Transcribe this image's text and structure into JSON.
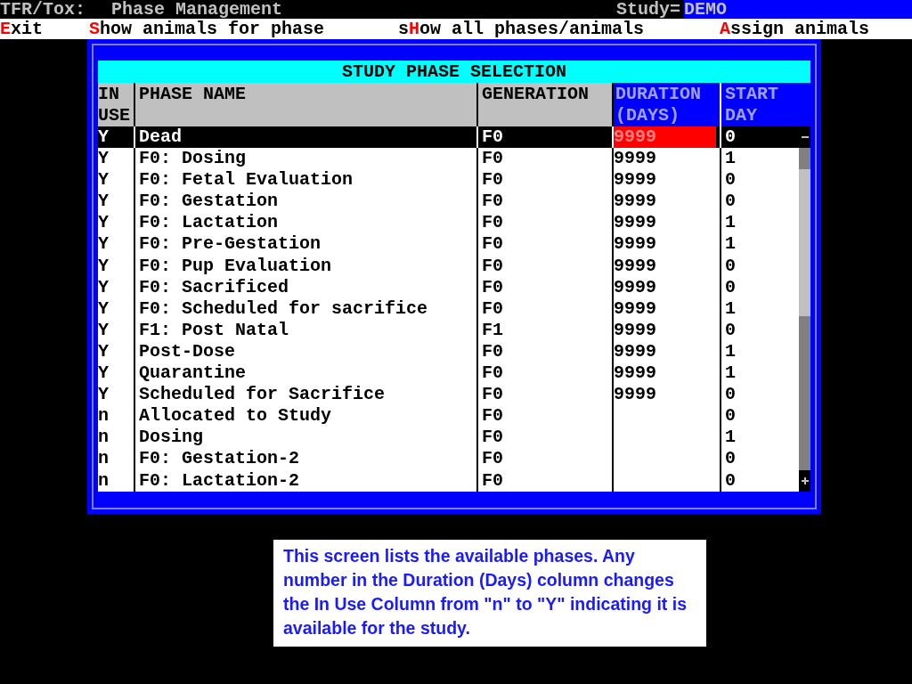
{
  "title_bar": {
    "app": "TFR/Tox:",
    "screen": "Phase Management",
    "study_label": "Study=",
    "study_value": "DEMO"
  },
  "menu": [
    {
      "key": "E",
      "after": "xit"
    },
    {
      "key": "S",
      "after": "how animals for phase"
    },
    {
      "before": "s",
      "key": "H",
      "after": "ow all phases/animals"
    },
    {
      "key": "A",
      "after": "ssign animals"
    }
  ],
  "panel": {
    "title": "STUDY PHASE SELECTION",
    "columns": [
      {
        "lines": [
          "IN",
          "USE"
        ]
      },
      {
        "lines": [
          "PHASE NAME"
        ]
      },
      {
        "lines": [
          "GENERATION"
        ]
      },
      {
        "lines": [
          "DURATION",
          "(DAYS)"
        ]
      },
      {
        "lines": [
          "START",
          "DAY"
        ]
      }
    ],
    "rows": [
      {
        "in_use": "Y",
        "phase_name": "Dead",
        "generation": "F0",
        "duration": "9999",
        "start_day": "0",
        "selected": true
      },
      {
        "in_use": "Y",
        "phase_name": "F0: Dosing",
        "generation": "F0",
        "duration": "9999",
        "start_day": "1",
        "selected": false
      },
      {
        "in_use": "Y",
        "phase_name": "F0: Fetal Evaluation",
        "generation": "F0",
        "duration": "9999",
        "start_day": "0",
        "selected": false
      },
      {
        "in_use": "Y",
        "phase_name": "F0: Gestation",
        "generation": "F0",
        "duration": "9999",
        "start_day": "0",
        "selected": false
      },
      {
        "in_use": "Y",
        "phase_name": "F0: Lactation",
        "generation": "F0",
        "duration": "9999",
        "start_day": "1",
        "selected": false
      },
      {
        "in_use": "Y",
        "phase_name": "F0: Pre-Gestation",
        "generation": "F0",
        "duration": "9999",
        "start_day": "1",
        "selected": false
      },
      {
        "in_use": "Y",
        "phase_name": "F0: Pup Evaluation",
        "generation": "F0",
        "duration": "9999",
        "start_day": "0",
        "selected": false
      },
      {
        "in_use": "Y",
        "phase_name": "F0: Sacrificed",
        "generation": "F0",
        "duration": "9999",
        "start_day": "0",
        "selected": false
      },
      {
        "in_use": "Y",
        "phase_name": "F0: Scheduled for sacrifice",
        "generation": "F0",
        "duration": "9999",
        "start_day": "1",
        "selected": false
      },
      {
        "in_use": "Y",
        "phase_name": "F1: Post Natal",
        "generation": "F1",
        "duration": "9999",
        "start_day": "0",
        "selected": false
      },
      {
        "in_use": "Y",
        "phase_name": "Post-Dose",
        "generation": "F0",
        "duration": "9999",
        "start_day": "1",
        "selected": false
      },
      {
        "in_use": "Y",
        "phase_name": "Quarantine",
        "generation": "F0",
        "duration": "9999",
        "start_day": "1",
        "selected": false
      },
      {
        "in_use": "Y",
        "phase_name": "Scheduled for Sacrifice",
        "generation": "F0",
        "duration": "9999",
        "start_day": "0",
        "selected": false
      },
      {
        "in_use": "n",
        "phase_name": "Allocated to Study",
        "generation": "F0",
        "start_day": "0",
        "selected": false
      },
      {
        "in_use": "n",
        "phase_name": "Dosing",
        "generation": "F0",
        "start_day": "1",
        "selected": false
      },
      {
        "in_use": "n",
        "phase_name": "F0: Gestation-2",
        "generation": "F0",
        "start_day": "0",
        "selected": false
      },
      {
        "in_use": "n",
        "phase_name": "F0: Lactation-2",
        "generation": "F0",
        "start_day": "0",
        "selected": false
      }
    ]
  },
  "caption": "This screen lists the available phases. Any number in the Duration (Days) column changes the In Use Column from \"n\" to \"Y\" indicating it is available for the study."
}
